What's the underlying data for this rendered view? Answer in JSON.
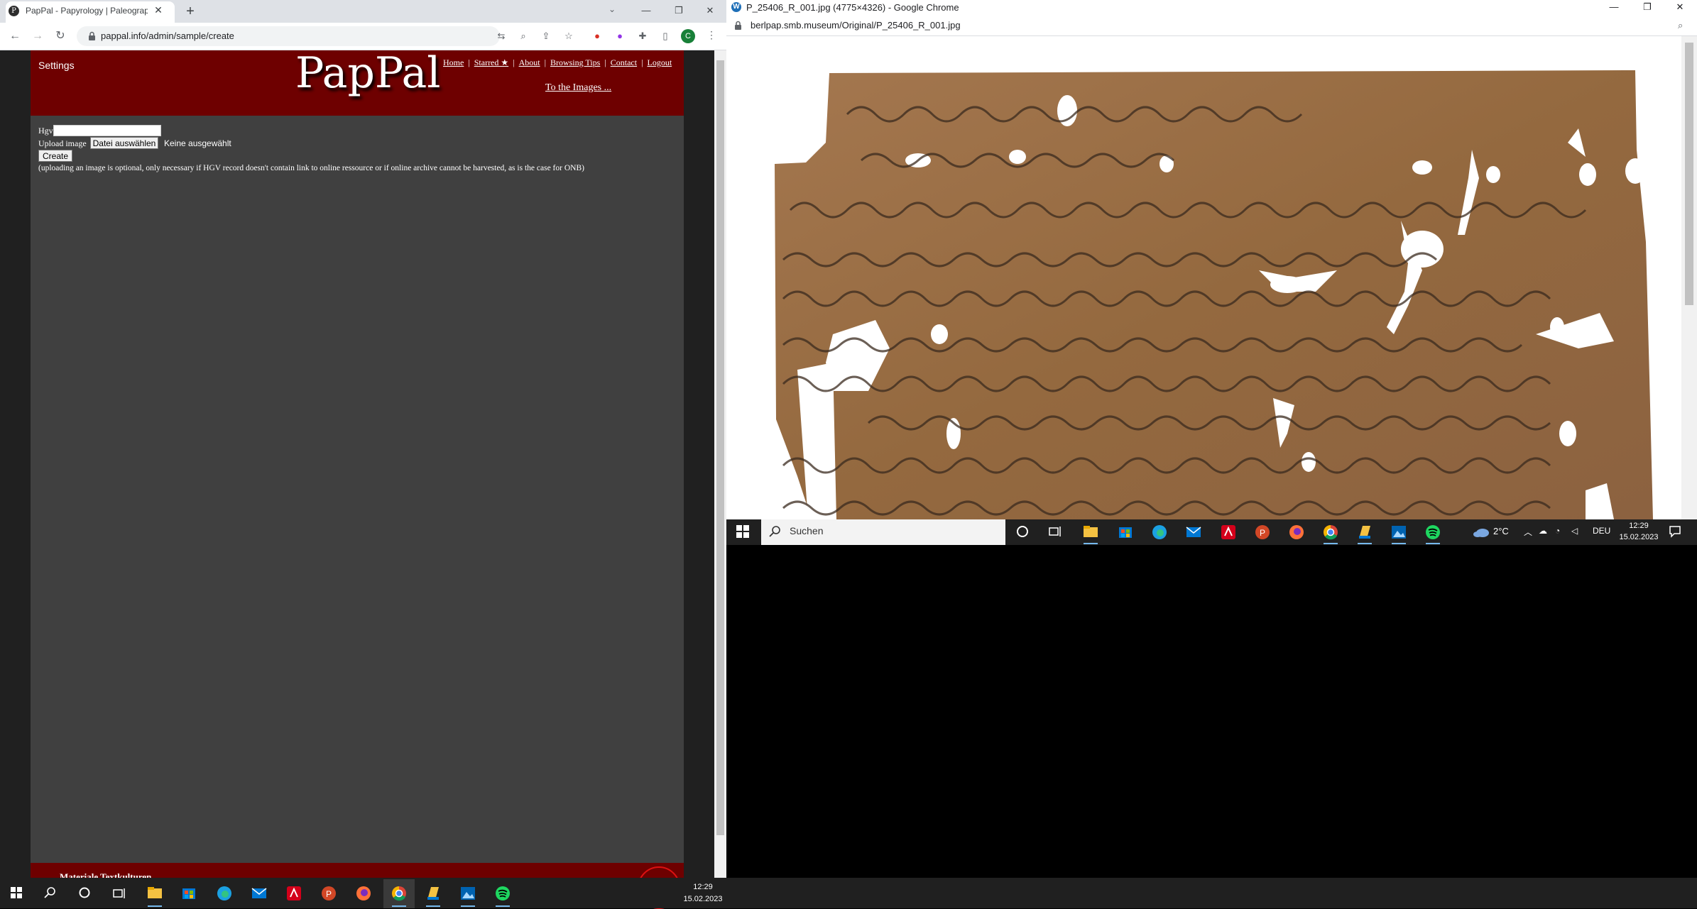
{
  "left_browser": {
    "tab_title": "PapPal - Papyrology | Paleograph",
    "tab_favicon": "pappal-favicon",
    "url": "pappal.info/admin/sample/create",
    "profile_initial": "C"
  },
  "pappal": {
    "settings_label": "Settings",
    "logo": "PapPal",
    "nav": [
      "Home",
      "Starred ★",
      "About",
      "Browsing Tips",
      "Contact",
      "Logout"
    ],
    "to_images": "To the Images ...",
    "form": {
      "hgv_label": "Hgv",
      "hgv_value": "",
      "upload_label": "Upload image",
      "file_button": "Datei auswählen",
      "file_status": "Keine ausgewählt",
      "create_button": "Create",
      "note": "(uploading an image is optional, only necessary if HGV record doesn't contain link to online ressource or if online archive cannot be harvested, as is the case for ONB)"
    },
    "footer_text": "Materiale Textkulturen"
  },
  "right_browser": {
    "window_title": "P_25406_R_001.jpg (4775×4326) - Google Chrome",
    "url": "berlpap.smb.museum/Original/P_25406_R_001.jpg",
    "image_description_icon": "papyrus-image"
  },
  "right_taskbar": {
    "search_placeholder": "Suchen",
    "temperature": "2°C",
    "language": "DEU",
    "time": "12:29",
    "date": "15.02.2023",
    "apps": [
      "cortana",
      "task-view",
      "file-explorer",
      "store",
      "edge",
      "mail",
      "acrobat",
      "powerpoint",
      "firefox",
      "chrome",
      "files",
      "photos",
      "spotify"
    ]
  },
  "bottom_taskbar": {
    "time": "12:29",
    "date": "15.02.2023",
    "apps": [
      "start",
      "search",
      "cortana",
      "task-view",
      "file-explorer",
      "store",
      "edge",
      "mail",
      "acrobat",
      "powerpoint",
      "firefox",
      "chrome",
      "files",
      "photos",
      "spotify"
    ]
  },
  "colors": {
    "pappal_header": "#6e0000",
    "pappal_body": "#404040",
    "papyrus": "#9b6e49",
    "taskbar": "#202020"
  }
}
